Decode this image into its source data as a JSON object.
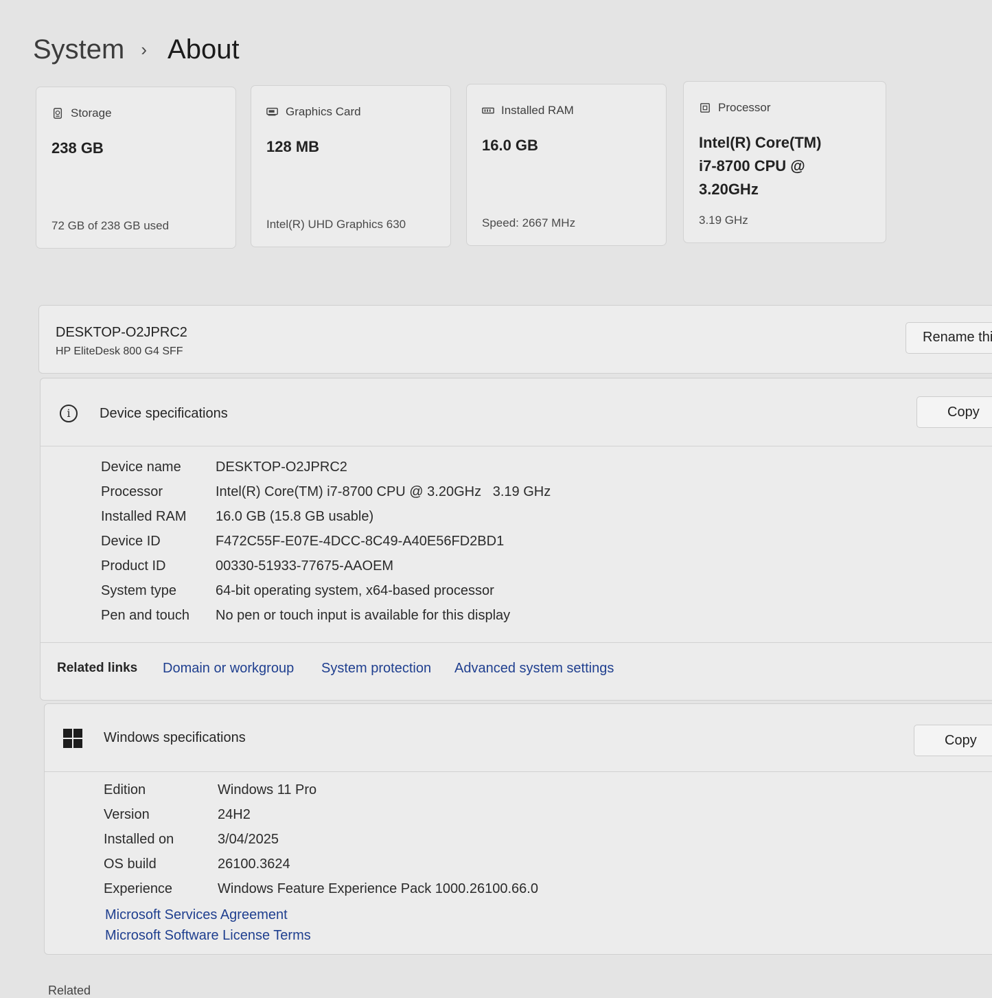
{
  "breadcrumb": {
    "parent": "System",
    "separator": "›",
    "current": "About"
  },
  "cards": [
    {
      "icon": "storage-icon",
      "title": "Storage",
      "value": "238 GB",
      "sub": "72 GB of 238 GB used"
    },
    {
      "icon": "graphics-card-icon",
      "title": "Graphics Card",
      "value": "128 MB",
      "sub": "Intel(R) UHD Graphics 630"
    },
    {
      "icon": "ram-icon",
      "title": "Installed RAM",
      "value": "16.0 GB",
      "sub": "Speed: 2667 MHz"
    },
    {
      "icon": "processor-icon",
      "title": "Processor",
      "value_lines": [
        "Intel(R) Core(TM)",
        "i7-8700 CPU @",
        "3.20GHz"
      ],
      "sub": "3.19 GHz"
    }
  ],
  "device": {
    "name": "DESKTOP-O2JPRC2",
    "model": "HP EliteDesk 800 G4 SFF",
    "rename_label": "Rename thi"
  },
  "device_specs": {
    "title": "Device specifications",
    "copy_label": "Copy",
    "rows": [
      {
        "label": "Device name",
        "value": "DESKTOP-O2JPRC2"
      },
      {
        "label": "Processor",
        "value": "Intel(R) Core(TM) i7-8700 CPU @ 3.20GHz   3.19 GHz"
      },
      {
        "label": "Installed RAM",
        "value": "16.0 GB (15.8 GB usable)"
      },
      {
        "label": "Device ID",
        "value": "F472C55F-E07E-4DCC-8C49-A40E56FD2BD1"
      },
      {
        "label": "Product ID",
        "value": "00330-51933-77675-AAOEM"
      },
      {
        "label": "System type",
        "value": "64-bit operating system, x64-based processor"
      },
      {
        "label": "Pen and touch",
        "value": "No pen or touch input is available for this display"
      }
    ]
  },
  "related_links": {
    "title": "Related links",
    "links": [
      "Domain or workgroup",
      "System protection",
      "Advanced system settings"
    ]
  },
  "windows_specs": {
    "title": "Windows specifications",
    "copy_label": "Copy",
    "rows": [
      {
        "label": "Edition",
        "value": "Windows 11 Pro"
      },
      {
        "label": "Version",
        "value": "24H2"
      },
      {
        "label": "Installed on",
        "value": "3/04/2025"
      },
      {
        "label": "OS build",
        "value": "26100.3624"
      },
      {
        "label": "Experience",
        "value": "Windows Feature Experience Pack 1000.26100.66.0"
      }
    ],
    "links": [
      "Microsoft Services Agreement",
      "Microsoft Software License Terms"
    ]
  },
  "bottom_partial": "Related"
}
